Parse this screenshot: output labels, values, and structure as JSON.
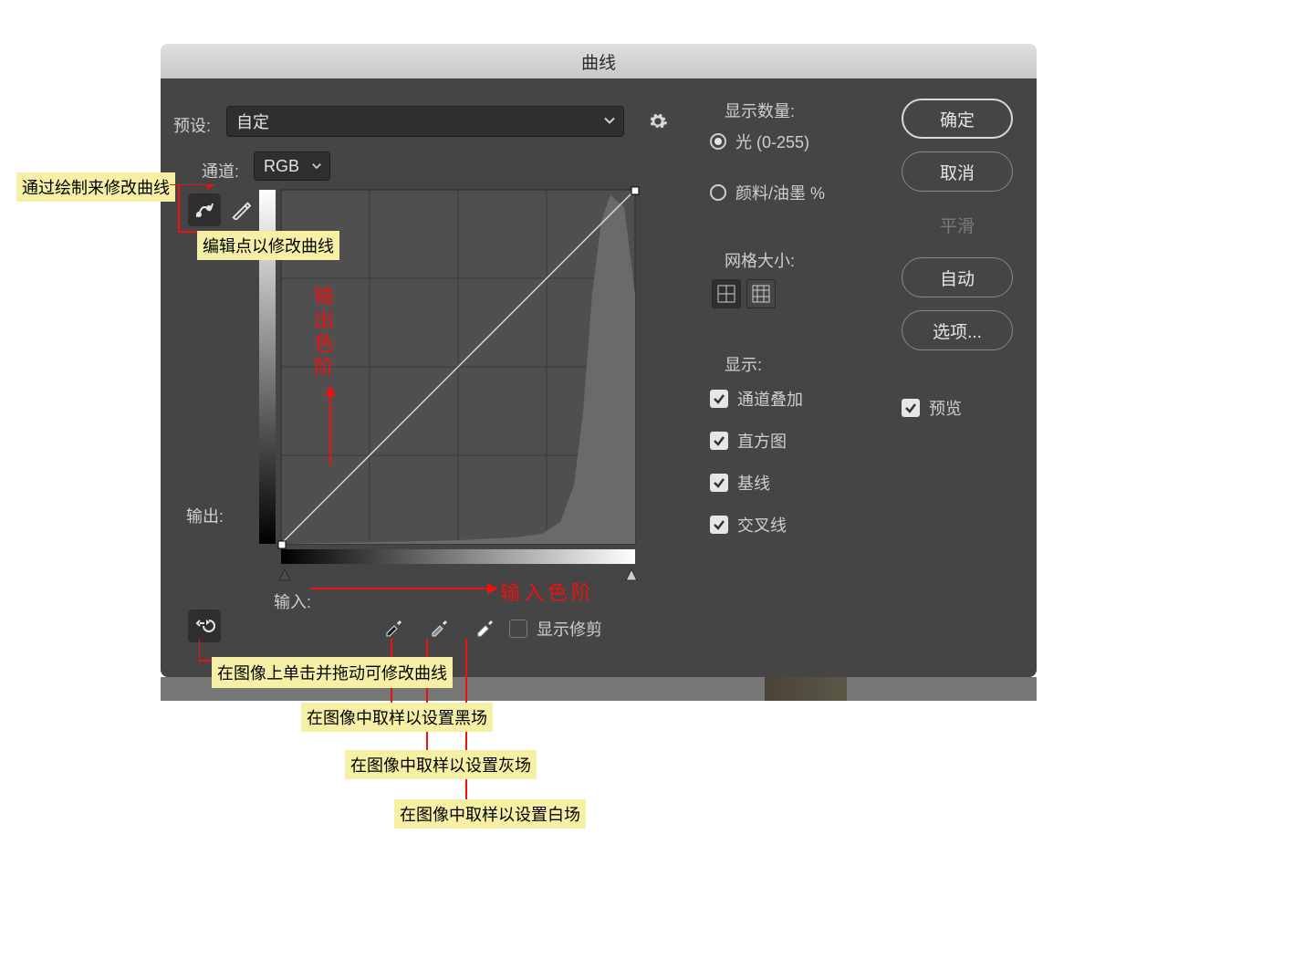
{
  "title": "曲线",
  "preset": {
    "label": "预设:",
    "value": "自定"
  },
  "channel": {
    "label": "通道:",
    "value": "RGB"
  },
  "output_label": "输出:",
  "input_label": "输入:",
  "show_clipping": "显示修剪",
  "display_amount": {
    "title": "显示数量:",
    "light": "光 (0-255)",
    "pigment": "颜料/油墨 %"
  },
  "grid_size_title": "网格大小:",
  "show": {
    "title": "显示:",
    "channel_overlay": "通道叠加",
    "histogram": "直方图",
    "baseline": "基线",
    "intersection": "交叉线"
  },
  "buttons": {
    "ok": "确定",
    "cancel": "取消",
    "smooth": "平滑",
    "auto": "自动",
    "options": "选项..."
  },
  "preview": "预览",
  "annotations": {
    "draw_modify": "通过绘制来修改曲线",
    "edit_points": "编辑点以修改曲线",
    "output_levels": "输出色阶",
    "input_levels": "输入色阶",
    "drag_modify": "在图像上单击并拖动可修改曲线",
    "sample_black": "在图像中取样以设置黑场",
    "sample_gray": "在图像中取样以设置灰场",
    "sample_white": "在图像中取样以设置白场"
  },
  "chart_data": {
    "type": "line",
    "title": "Curves",
    "xlabel": "Input",
    "ylabel": "Output",
    "xlim": [
      0,
      255
    ],
    "ylim": [
      0,
      255
    ],
    "series": [
      {
        "name": "curve",
        "values": [
          [
            0,
            0
          ],
          [
            255,
            255
          ]
        ]
      }
    ],
    "histogram": {
      "comment": "visually peaked near highlights",
      "x": [
        0,
        50,
        100,
        150,
        180,
        200,
        210,
        220,
        225,
        230,
        235,
        240,
        245,
        250,
        255
      ],
      "y": [
        2,
        3,
        4,
        5,
        7,
        10,
        18,
        40,
        120,
        210,
        245,
        250,
        240,
        180,
        60
      ]
    }
  }
}
